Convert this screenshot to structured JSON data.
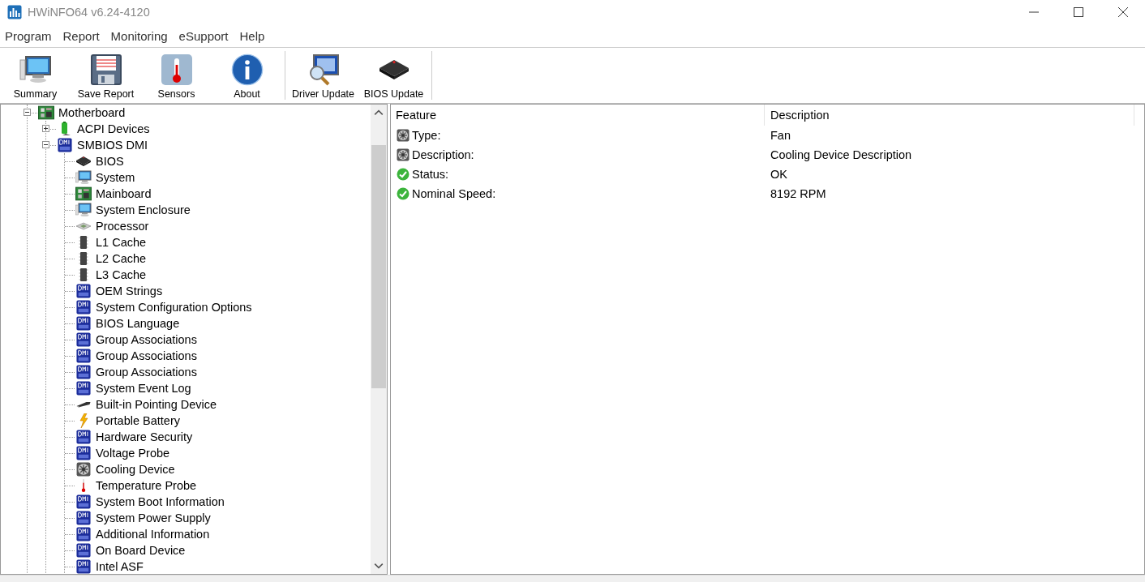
{
  "window": {
    "title": "HWiNFO64 v6.24-4120"
  },
  "menu": [
    "Program",
    "Report",
    "Monitoring",
    "eSupport",
    "Help"
  ],
  "toolbar": [
    [
      {
        "label": "Summary",
        "kind": "monitor"
      },
      {
        "label": "Save Report",
        "kind": "floppy"
      },
      {
        "label": "Sensors",
        "kind": "thermo"
      },
      {
        "label": "About",
        "kind": "info"
      }
    ],
    [
      {
        "label": "Driver Update",
        "kind": "magnifier"
      },
      {
        "label": "BIOS Update",
        "kind": "chip"
      }
    ]
  ],
  "tree": [
    {
      "label": "Motherboard",
      "kind": "board",
      "expanded": true,
      "children": [
        {
          "label": "ACPI Devices",
          "kind": "acpi",
          "expanded": false
        },
        {
          "label": "SMBIOS DMI",
          "kind": "dmi",
          "expanded": true,
          "children": [
            {
              "label": "BIOS",
              "kind": "chip"
            },
            {
              "label": "System",
              "kind": "monitor"
            },
            {
              "label": "Mainboard",
              "kind": "board"
            },
            {
              "label": "System Enclosure",
              "kind": "monitor"
            },
            {
              "label": "Processor",
              "kind": "cpu"
            },
            {
              "label": "L1 Cache",
              "kind": "cache"
            },
            {
              "label": "L2 Cache",
              "kind": "cache"
            },
            {
              "label": "L3 Cache",
              "kind": "cache"
            },
            {
              "label": "OEM Strings",
              "kind": "dmi"
            },
            {
              "label": "System Configuration Options",
              "kind": "dmi"
            },
            {
              "label": "BIOS Language",
              "kind": "dmi"
            },
            {
              "label": "Group Associations",
              "kind": "dmi"
            },
            {
              "label": "Group Associations",
              "kind": "dmi"
            },
            {
              "label": "Group Associations",
              "kind": "dmi"
            },
            {
              "label": "System Event Log",
              "kind": "dmi"
            },
            {
              "label": "Built-in Pointing Device",
              "kind": "mouse"
            },
            {
              "label": "Portable Battery",
              "kind": "battery"
            },
            {
              "label": "Hardware Security",
              "kind": "dmi"
            },
            {
              "label": "Voltage Probe",
              "kind": "dmi"
            },
            {
              "label": "Cooling Device",
              "kind": "fan"
            },
            {
              "label": "Temperature Probe",
              "kind": "thermo"
            },
            {
              "label": "System Boot Information",
              "kind": "dmi"
            },
            {
              "label": "System Power Supply",
              "kind": "dmi"
            },
            {
              "label": "Additional Information",
              "kind": "dmi"
            },
            {
              "label": "On Board Device",
              "kind": "dmi"
            },
            {
              "label": "Intel ASF",
              "kind": "dmi"
            }
          ]
        }
      ]
    }
  ],
  "table": {
    "columns": [
      "Feature",
      "Description"
    ],
    "rows": [
      {
        "feature": "Type:",
        "value": "Fan",
        "kind": "fan"
      },
      {
        "feature": "Description:",
        "value": "Cooling Device Description",
        "kind": "fan"
      },
      {
        "feature": "Status:",
        "value": "OK",
        "kind": "ok"
      },
      {
        "feature": "Nominal Speed:",
        "value": "8192 RPM",
        "kind": "ok"
      }
    ]
  }
}
